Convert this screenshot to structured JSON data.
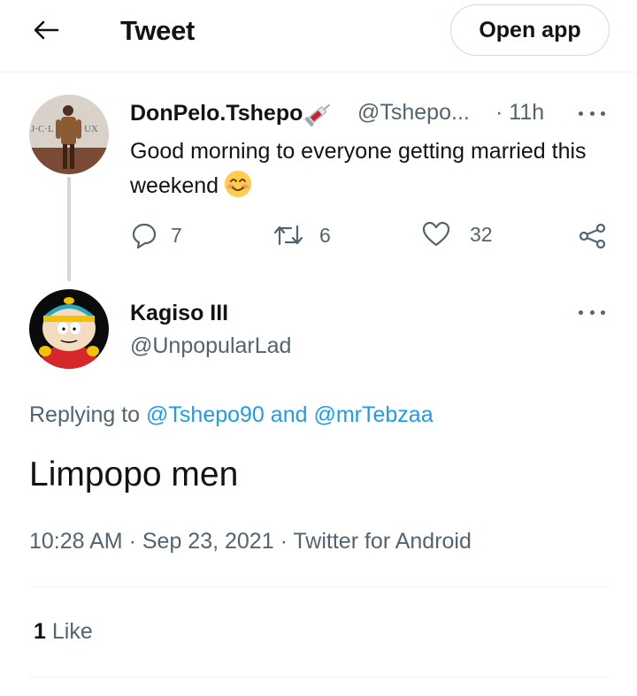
{
  "header": {
    "title": "Tweet",
    "open_app_label": "Open app"
  },
  "parent_tweet": {
    "display_name": "DonPelo.Tshepo",
    "handle": "@Tshepo...",
    "time": "· 11h",
    "text": "Good morning to everyone getting married this weekend",
    "replies": "7",
    "retweets": "6",
    "likes": "32",
    "name_badge_icon": "syringe-icon",
    "text_emoji_icon": "smiling-face-icon"
  },
  "reply_tweet": {
    "display_name": "Kagiso III",
    "handle": "@UnpopularLad",
    "replying_prefix": "Replying to",
    "mention_1": "@Tshepo90",
    "mention_join": "and",
    "mention_2": "@mrTebzaa",
    "text": "Limpopo men",
    "time": "10:28 AM",
    "date": "Sep 23, 2021",
    "source": "Twitter for Android",
    "meta_sep": "·",
    "like_count": "1",
    "like_label": "Like"
  },
  "colors": {
    "accent": "#1d9bf0",
    "text_primary": "#0f1419",
    "text_secondary": "#536471",
    "border": "#eff3f4"
  }
}
